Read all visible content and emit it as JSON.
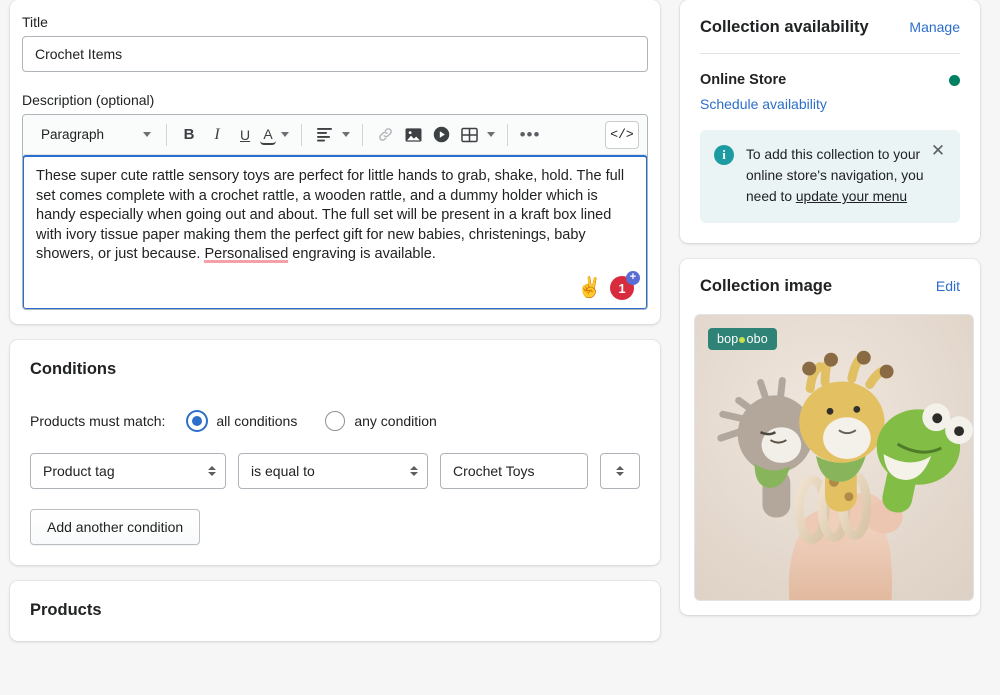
{
  "main": {
    "title_field": {
      "label": "Title",
      "value": "Crochet Items"
    },
    "description_field": {
      "label": "Description (optional)",
      "toolbar": {
        "block_style": "Paragraph",
        "bold": "B",
        "italic": "I",
        "underline": "U",
        "text_color": "A",
        "align": "align-left-icon",
        "link": "link-icon",
        "image": "image-icon",
        "video": "video-icon",
        "table": "table-icon",
        "more": "•••",
        "code": "</>"
      },
      "body_text_before": "These super cute rattle sensory toys are perfect for little hands to grab, shake, hold. The full set comes complete with a crochet rattle, a wooden rattle, and a dummy holder which is handy especially when going out and about. The full set will be present in a kraft box lined with ivory tissue paper making them the perfect gift for new babies, christenings, baby showers, or just because. ",
      "body_misspelled_word": "Personalised",
      "body_text_after": " engraving is available.",
      "badge_hand": "✌",
      "badge_count": "1",
      "badge_plus": "+"
    },
    "conditions": {
      "title": "Conditions",
      "match_label": "Products must match:",
      "options": [
        {
          "label": "all conditions",
          "selected": true
        },
        {
          "label": "any condition",
          "selected": false
        }
      ],
      "rule": {
        "field": "Product tag",
        "operator": "is equal to",
        "value": "Crochet Toys"
      },
      "add_button": "Add another condition"
    },
    "products": {
      "title": "Products"
    }
  },
  "sidebar": {
    "availability": {
      "title": "Collection availability",
      "manage_link": "Manage",
      "channel": "Online Store",
      "status_color": "#008060",
      "schedule_link": "Schedule availability",
      "banner": {
        "text_before": "To add this collection to your online store's navigation, you need to ",
        "link": "update your menu",
        "close": "✕",
        "icon": "info-icon"
      }
    },
    "collection_image": {
      "title": "Collection image",
      "edit_link": "Edit",
      "watermark": {
        "part1": "bop",
        "part2": "obo"
      }
    }
  }
}
